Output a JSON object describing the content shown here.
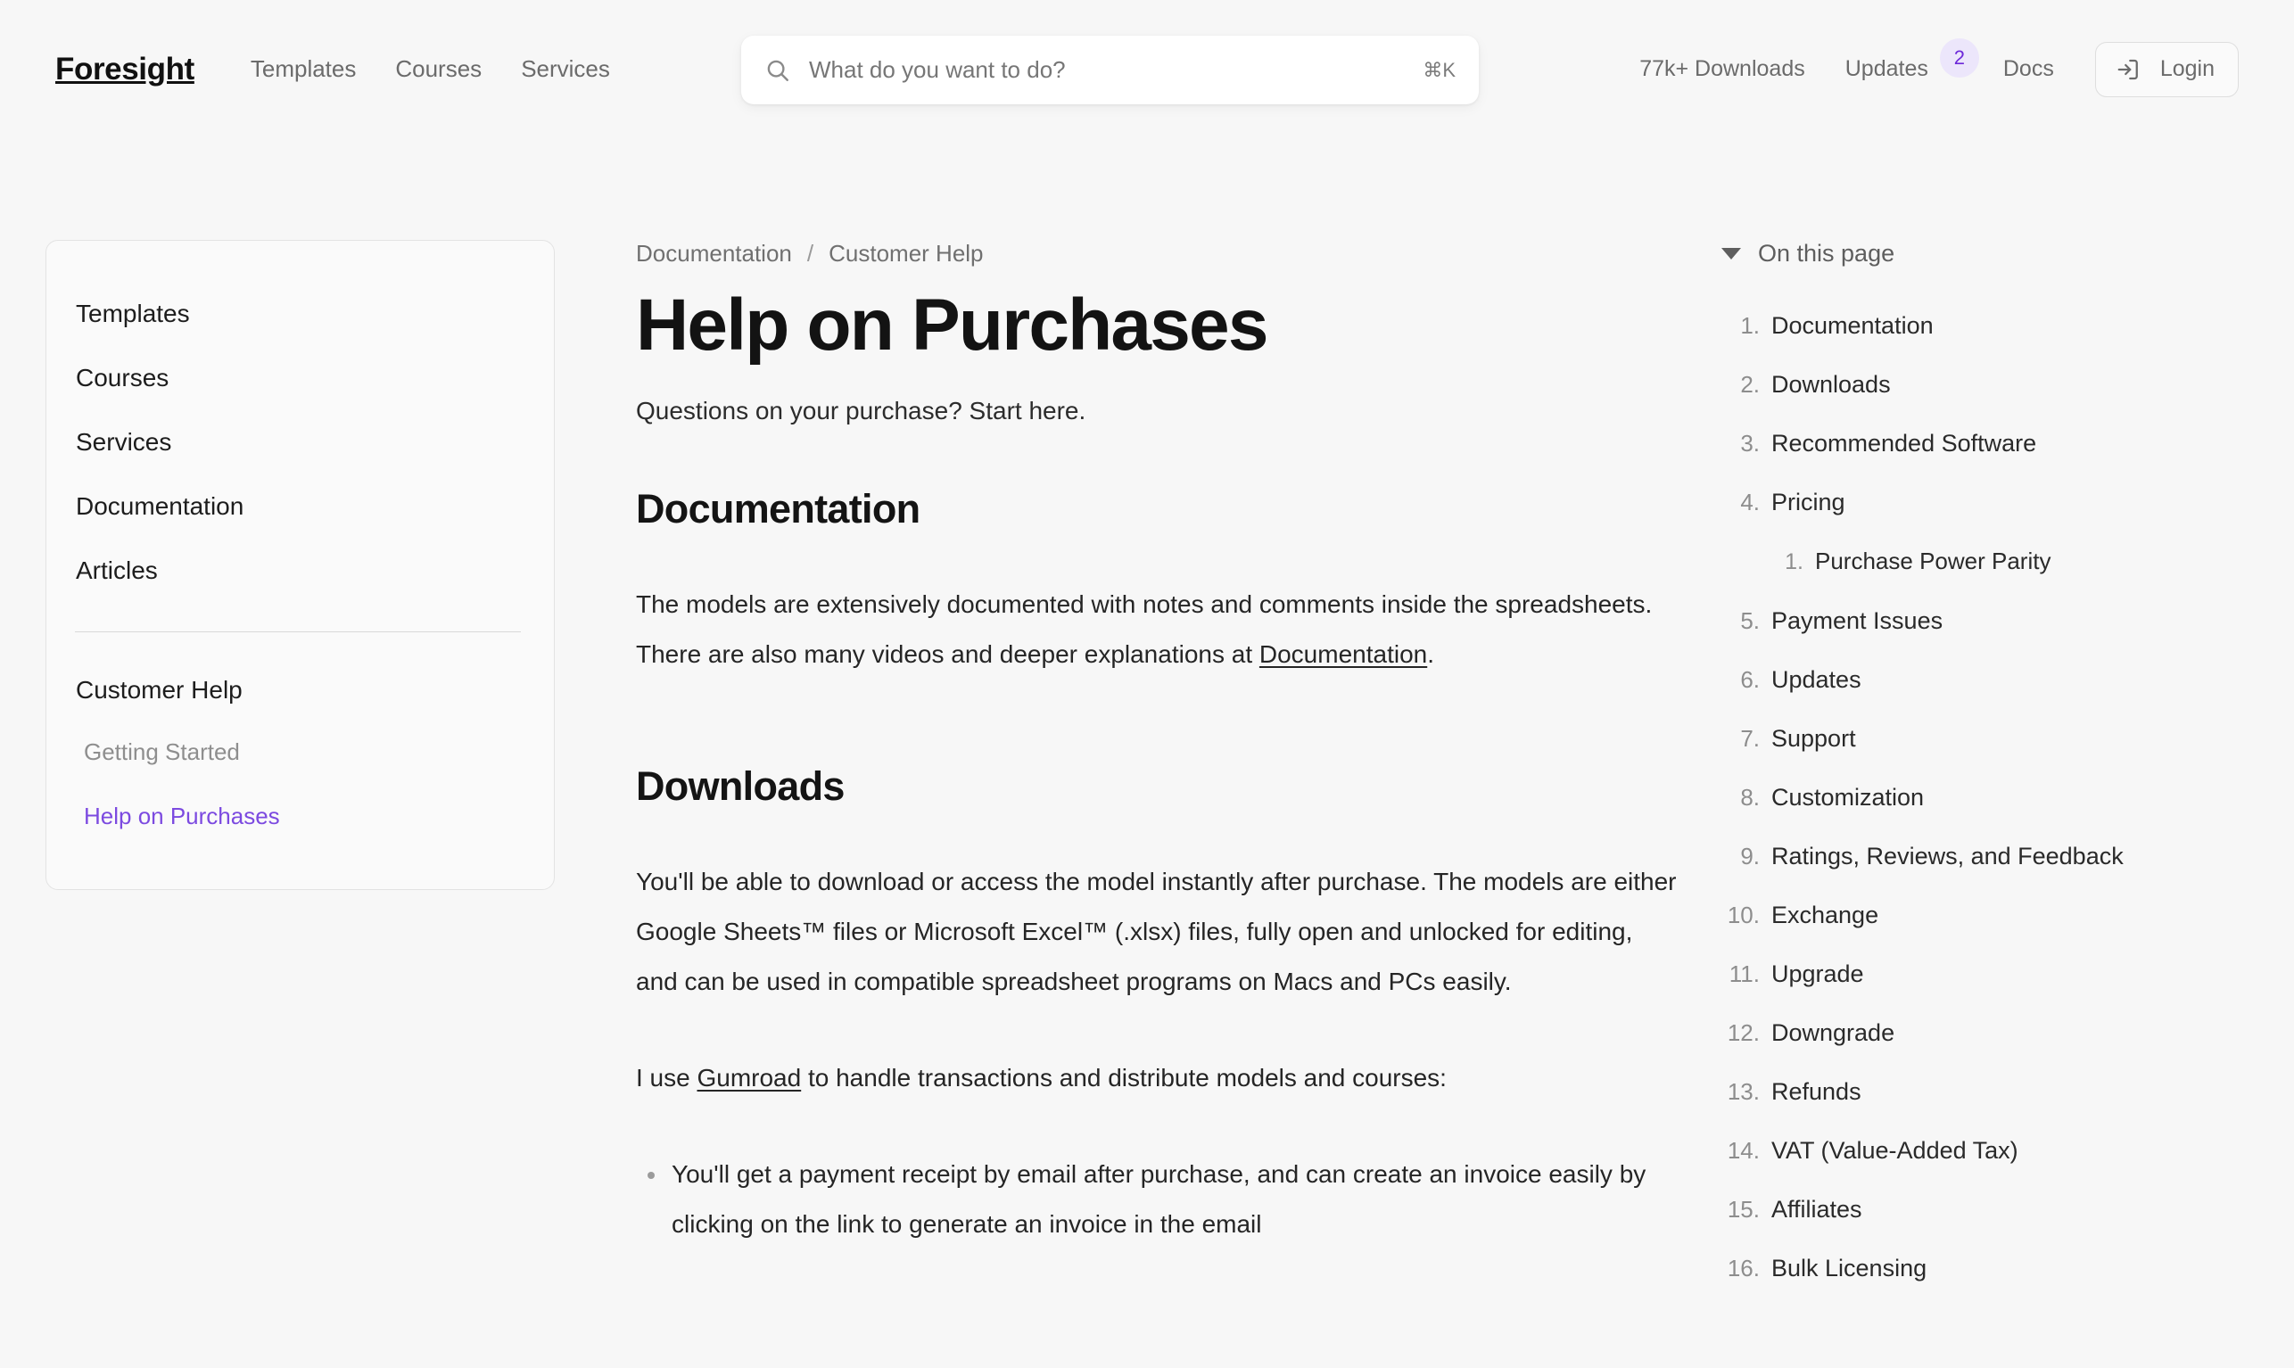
{
  "header": {
    "brand": "Foresight",
    "nav": [
      {
        "label": "Templates"
      },
      {
        "label": "Courses"
      },
      {
        "label": "Services"
      }
    ],
    "search": {
      "placeholder": "What do you want to do?",
      "value": "",
      "shortcut": "⌘K",
      "icon": "search-icon"
    },
    "downloads_label": "77k+ Downloads",
    "updates_label": "Updates",
    "updates_badge": "2",
    "docs_label": "Docs",
    "login_label": "Login",
    "login_icon": "login-icon",
    "accent_color": "#7c4ae0",
    "badge_bg": "#ece6fb",
    "badge_fg": "#6d28d9"
  },
  "sidebar": {
    "items": [
      {
        "label": "Templates"
      },
      {
        "label": "Courses"
      },
      {
        "label": "Services"
      },
      {
        "label": "Documentation"
      },
      {
        "label": "Articles"
      }
    ],
    "section_label": "Customer Help",
    "sub_items": [
      {
        "label": "Getting Started",
        "active": false
      },
      {
        "label": "Help on Purchases",
        "active": true
      }
    ]
  },
  "main": {
    "breadcrumb": {
      "root": "Documentation",
      "separator": "/",
      "current": "Customer Help"
    },
    "title": "Help on Purchases",
    "subtitle": "Questions on your purchase? Start here.",
    "sections": [
      {
        "heading": "Documentation",
        "paragraph_prefix": "The models are extensively documented with notes and comments inside the spreadsheets. There are also many videos and deeper explanations at ",
        "paragraph_link": "Documentation",
        "paragraph_suffix": "."
      },
      {
        "heading": "Downloads",
        "paragraph": "You'll be able to download or access the model instantly after purchase. The models are either Google Sheets™ files or Microsoft Excel™ (.xlsx) files, fully open and unlocked for editing, and can be used in compatible spreadsheet programs on Macs and PCs easily.",
        "lead_prefix": "I use ",
        "lead_link": "Gumroad",
        "lead_suffix": " to handle transactions and distribute models and courses:",
        "bullets": [
          "You'll get a payment receipt by email after purchase, and can create an invoice easily by clicking on the link to generate an invoice in the email"
        ]
      }
    ]
  },
  "toc": {
    "title": "On this page",
    "caret_icon": "chevron-down-icon",
    "items": [
      {
        "num": "1.",
        "label": "Documentation",
        "sub": false
      },
      {
        "num": "2.",
        "label": "Downloads",
        "sub": false
      },
      {
        "num": "3.",
        "label": "Recommended Software",
        "sub": false
      },
      {
        "num": "4.",
        "label": "Pricing",
        "sub": false
      },
      {
        "num": "1.",
        "label": "Purchase Power Parity",
        "sub": true
      },
      {
        "num": "5.",
        "label": "Payment Issues",
        "sub": false
      },
      {
        "num": "6.",
        "label": "Updates",
        "sub": false
      },
      {
        "num": "7.",
        "label": "Support",
        "sub": false
      },
      {
        "num": "8.",
        "label": "Customization",
        "sub": false
      },
      {
        "num": "9.",
        "label": "Ratings, Reviews, and Feedback",
        "sub": false
      },
      {
        "num": "10.",
        "label": "Exchange",
        "sub": false
      },
      {
        "num": "11.",
        "label": "Upgrade",
        "sub": false
      },
      {
        "num": "12.",
        "label": "Downgrade",
        "sub": false
      },
      {
        "num": "13.",
        "label": "Refunds",
        "sub": false
      },
      {
        "num": "14.",
        "label": "VAT (Value-Added Tax)",
        "sub": false
      },
      {
        "num": "15.",
        "label": "Affiliates",
        "sub": false
      },
      {
        "num": "16.",
        "label": "Bulk Licensing",
        "sub": false
      }
    ]
  }
}
